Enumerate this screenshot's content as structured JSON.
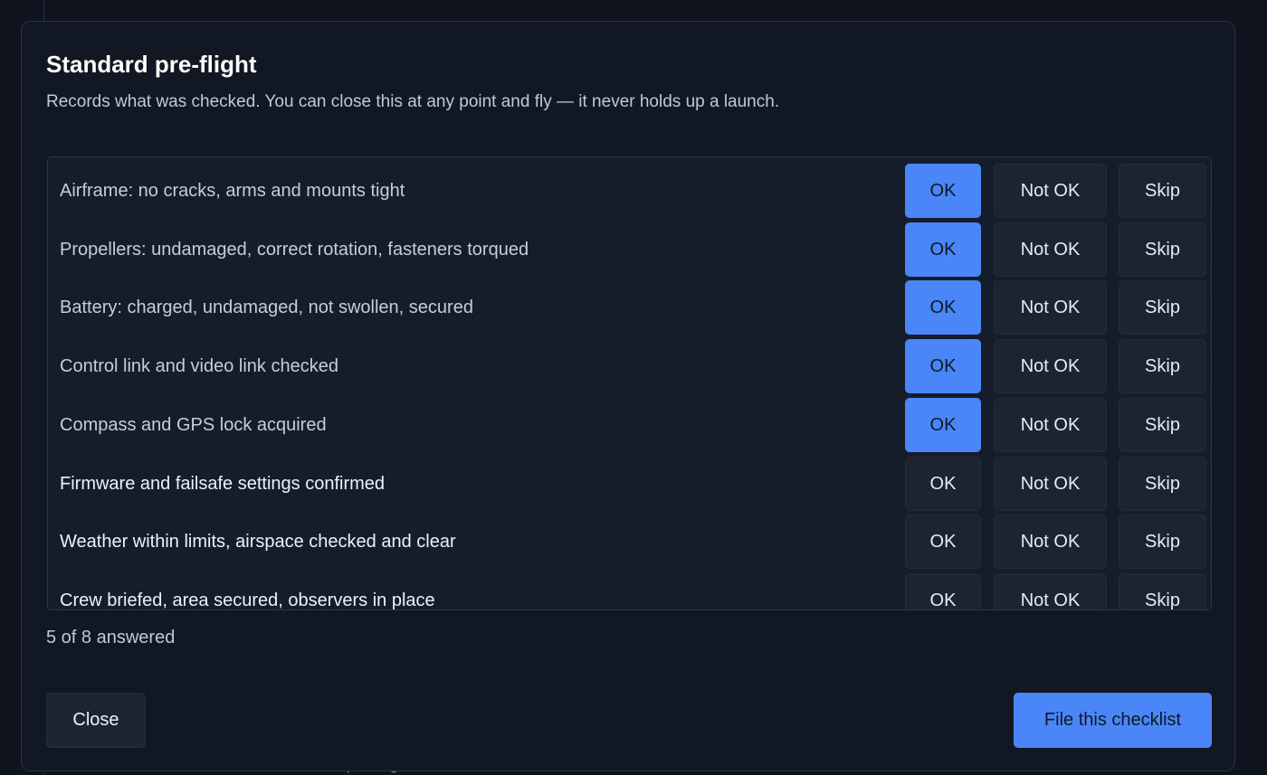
{
  "background": {
    "partial_text": "otid ... pollis g"
  },
  "dialog": {
    "title": "Standard pre-flight",
    "subtitle": "Records what was checked. You can close this at any point and fly — it never holds up a launch.",
    "option_labels": {
      "ok": "OK",
      "not_ok": "Not OK",
      "skip": "Skip"
    },
    "items": [
      {
        "label": "Airframe: no cracks, arms and mounts tight",
        "selected": "ok"
      },
      {
        "label": "Propellers: undamaged, correct rotation, fasteners torqued",
        "selected": "ok"
      },
      {
        "label": "Battery: charged, undamaged, not swollen, secured",
        "selected": "ok"
      },
      {
        "label": "Control link and video link checked",
        "selected": "ok"
      },
      {
        "label": "Compass and GPS lock acquired",
        "selected": "ok"
      },
      {
        "label": "Firmware and failsafe settings confirmed",
        "selected": null
      },
      {
        "label": "Weather within limits, airspace checked and clear",
        "selected": null
      },
      {
        "label": "Crew briefed, area secured, observers in place",
        "selected": null
      }
    ],
    "progress_text": "5 of 8 answered",
    "close_label": "Close",
    "file_label": "File this checklist"
  },
  "colors": {
    "accent": "#4a86f7",
    "modal_bg": "#121823",
    "list_bg": "#161d2a",
    "button_bg": "#1d2431"
  }
}
